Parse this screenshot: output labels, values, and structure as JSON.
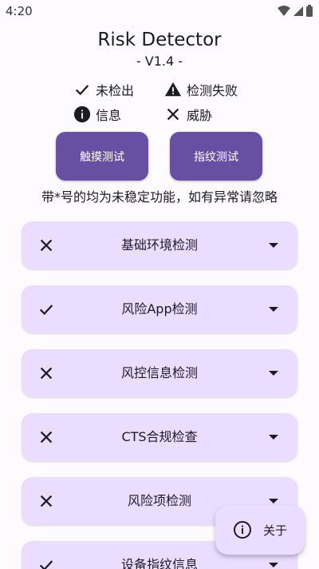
{
  "status_bar": {
    "time": "4:20"
  },
  "header": {
    "title": "Risk Detector",
    "version": "- V1.4 -"
  },
  "legend": {
    "not_detected": "未检出",
    "detection_failed": "检测失败",
    "info": "信息",
    "threat": "威胁"
  },
  "buttons": {
    "touch_test": "触摸测试",
    "fingerprint_test": "指纹测试"
  },
  "notice": "带*号的均为未稳定功能，如有异常请忽略",
  "cards": [
    {
      "label": "基础环境检测",
      "state": "threat"
    },
    {
      "label": "风险App检测",
      "state": "not_detected"
    },
    {
      "label": "风控信息检测",
      "state": "threat"
    },
    {
      "label": "CTS合规检查",
      "state": "threat"
    },
    {
      "label": "风险项检测",
      "state": "threat"
    },
    {
      "label": "设备指纹信息",
      "state": "not_detected"
    }
  ],
  "fab": {
    "label": "关于"
  }
}
